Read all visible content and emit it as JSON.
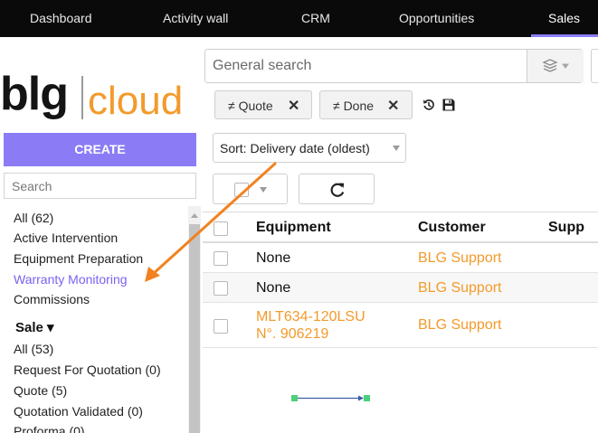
{
  "topnav": {
    "items": [
      {
        "label": "Dashboard"
      },
      {
        "label": "Activity wall"
      },
      {
        "label": "CRM"
      },
      {
        "label": "Opportunities"
      },
      {
        "label": "Sales",
        "active": true
      }
    ],
    "accent_color": "#8b7cf6"
  },
  "logo": {
    "part1": "blg",
    "part2": "cloud",
    "part2_color": "#f39a2b"
  },
  "search": {
    "placeholder": "General search",
    "value": "",
    "layers_icon": "layers-icon"
  },
  "filters": [
    {
      "label": "≠ Quote",
      "remove": "✕"
    },
    {
      "label": "≠ Done",
      "remove": "✕"
    }
  ],
  "filter_tools": {
    "history_icon": "history-icon",
    "save_icon": "save-icon"
  },
  "sidebar": {
    "create_label": "CREATE",
    "search_placeholder": "Search",
    "items": [
      {
        "label": "All (62)"
      },
      {
        "label": "Active Intervention"
      },
      {
        "label": "Equipment Preparation"
      },
      {
        "label": "Warranty Monitoring",
        "active": true
      },
      {
        "label": "Commissions"
      }
    ],
    "groups": [
      {
        "label": "Sale ▾",
        "items": [
          {
            "label": "All (53)"
          },
          {
            "label": "Request For Quotation (0)"
          },
          {
            "label": "Quote (5)"
          },
          {
            "label": "Quotation Validated (0)"
          },
          {
            "label": "Proforma (0)"
          }
        ]
      }
    ]
  },
  "toolbar": {
    "sort_label": "Sort: Delivery date (oldest)",
    "refresh_icon": "refresh-icon"
  },
  "table": {
    "columns": [
      "Equipment",
      "Customer",
      "Supp"
    ],
    "rows": [
      {
        "equipment": "None",
        "customer": "BLG Support"
      },
      {
        "equipment": "None",
        "customer": "BLG Support"
      },
      {
        "equipment": "MLT634-120LSU",
        "equipment_sub": "N°. 906219",
        "customer": "BLG Support"
      }
    ]
  },
  "annotation": {
    "color": "#f2821f"
  }
}
